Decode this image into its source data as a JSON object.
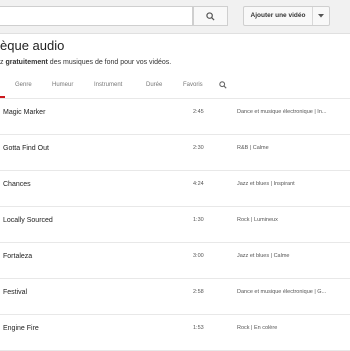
{
  "header": {
    "search_value": "",
    "upload_label": "Ajouter une vidéo"
  },
  "icons": {
    "search": "search-icon",
    "dropdown": "chevron-down-icon",
    "filter_search": "search-icon"
  },
  "colors": {
    "accent": "#cc181e",
    "topbar_bg": "#f1f1f1"
  },
  "page": {
    "title": "èque audio",
    "subtitle_prefix": "z ",
    "subtitle_bold": "gratuitement",
    "subtitle_suffix": " des musiques de fond pour vos vidéos."
  },
  "filters": {
    "genre": "Genre",
    "mood": "Humeur",
    "instrument": "Instrument",
    "duration": "Durée",
    "favorites": "Favoris"
  },
  "tracks": [
    {
      "title": "Magic Marker",
      "duration": "2:45",
      "genre": "Dance et musique électronique | In..."
    },
    {
      "title": "Gotta Find Out",
      "duration": "2:30",
      "genre": "R&B | Calme"
    },
    {
      "title": "Chances",
      "duration": "4:24",
      "genre": "Jazz et blues | Inspirant"
    },
    {
      "title": "Locally Sourced",
      "duration": "1:30",
      "genre": "Rock | Lumineux"
    },
    {
      "title": "Fortaleza",
      "duration": "3:00",
      "genre": "Jazz et blues | Calme"
    },
    {
      "title": "Festival",
      "duration": "2:58",
      "genre": "Dance et musique électronique | G..."
    },
    {
      "title": "Engine Fire",
      "duration": "1:53",
      "genre": "Rock | En colère"
    }
  ]
}
